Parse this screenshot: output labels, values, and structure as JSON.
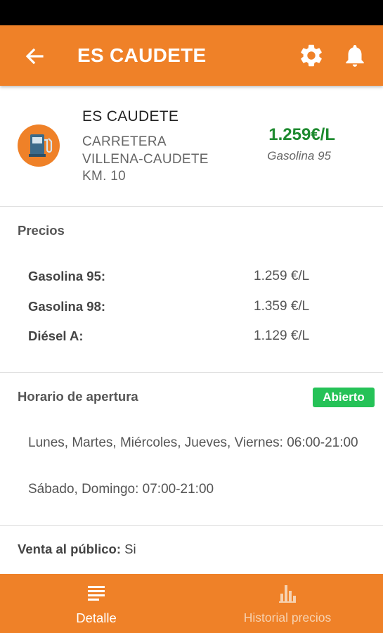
{
  "header": {
    "title": "ES CAUDETE",
    "back_icon": "arrow-left-icon",
    "settings_icon": "gear-icon",
    "notifications_icon": "bell-icon"
  },
  "station": {
    "name": "ES CAUDETE",
    "address_lines": [
      "CARRETERA",
      "VILLENA-CAUDETE",
      "KM. 10"
    ],
    "icon": "fuel-pump-icon",
    "main_price": "1.259€/L",
    "main_fuel": "Gasolina 95"
  },
  "prices": {
    "title": "Precios",
    "rows": [
      {
        "label": "Gasolina 95:",
        "value": "1.259 €/L"
      },
      {
        "label": "Gasolina 98:",
        "value": "1.359 €/L"
      },
      {
        "label": "Diésel A:",
        "value": "1.129 €/L"
      }
    ]
  },
  "hours": {
    "title": "Horario de apertura",
    "status": "Abierto",
    "lines": [
      "Lunes, Martes, Miércoles, Jueves, Viernes: 06:00-21:00",
      "Sábado, Domingo: 07:00-21:00"
    ]
  },
  "public_sale": {
    "label": "Venta al público:",
    "value": "Si"
  },
  "bottom_nav": {
    "items": [
      {
        "label": "Detalle",
        "icon": "list-icon",
        "active": true
      },
      {
        "label": "Historial precios",
        "icon": "bar-chart-icon",
        "active": false
      }
    ]
  },
  "colors": {
    "primary": "#ef8128",
    "price_green": "#1e8a2f",
    "open_badge": "#25c257"
  }
}
